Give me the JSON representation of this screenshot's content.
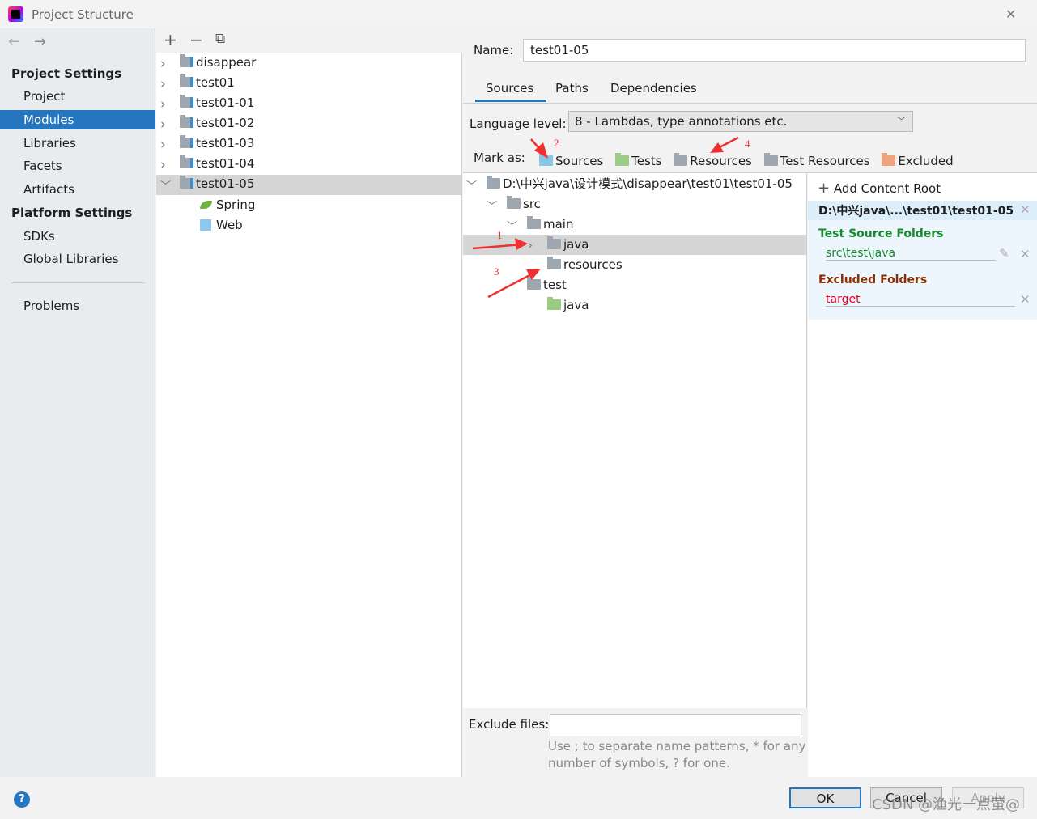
{
  "window": {
    "title": "Project Structure",
    "close": "✕"
  },
  "sidebar": {
    "back": "←",
    "forward": "→",
    "project_settings": "Project Settings",
    "items": [
      "Project",
      "Modules",
      "Libraries",
      "Facets",
      "Artifacts"
    ],
    "platform_settings": "Platform Settings",
    "platform_items": [
      "SDKs",
      "Global Libraries"
    ],
    "problems": "Problems"
  },
  "modules": {
    "toolbar": {
      "add": "+",
      "remove": "−",
      "copy": "⧉"
    },
    "items": [
      "disappear",
      "test01",
      "test01-01",
      "test01-02",
      "test01-03",
      "test01-04",
      "test01-05"
    ],
    "selected": "test01-05",
    "children": [
      "Spring",
      "Web"
    ]
  },
  "module": {
    "name_label": "Name:",
    "name_value": "test01-05",
    "tabs": [
      "Sources",
      "Paths",
      "Dependencies"
    ],
    "active_tab": "Sources",
    "language_label": "Language level:",
    "language_value": "8 - Lambdas, type annotations etc.",
    "mark_as_label": "Mark as:",
    "mark_as": [
      "Sources",
      "Tests",
      "Resources",
      "Test Resources",
      "Excluded"
    ],
    "tree": {
      "root": "D:\\中兴java\\设计模式\\disappear\\test01\\test01-05",
      "src": "src",
      "main": "main",
      "java": "java",
      "resources": "resources",
      "test": "test",
      "test_java": "java"
    },
    "content_root": {
      "add": "Add Content Root",
      "path": "D:\\中兴java\\...\\test01\\test01-05",
      "test_source_title": "Test Source Folders",
      "test_source": "src\\test\\java",
      "excluded_title": "Excluded Folders",
      "excluded": "target"
    },
    "exclude_label": "Exclude files:",
    "exclude_value": "",
    "hint_line1": "Use ; to separate name patterns, * for any",
    "hint_line2": "number of symbols, ? for one."
  },
  "annotations": [
    "1",
    "2",
    "3",
    "4"
  ],
  "buttons": {
    "ok": "OK",
    "cancel": "Cancel",
    "apply": "Apply",
    "help": "?"
  },
  "watermark": "CSDN @渔光一点萤@",
  "colors": {
    "selection": "#2675bf",
    "sources": "#87c7e6",
    "tests": "#9ccc84",
    "excluded": "#f0a27a",
    "test_green": "#178a2e",
    "excluded_brown": "#8b2d00",
    "arrow": "#f03030"
  }
}
